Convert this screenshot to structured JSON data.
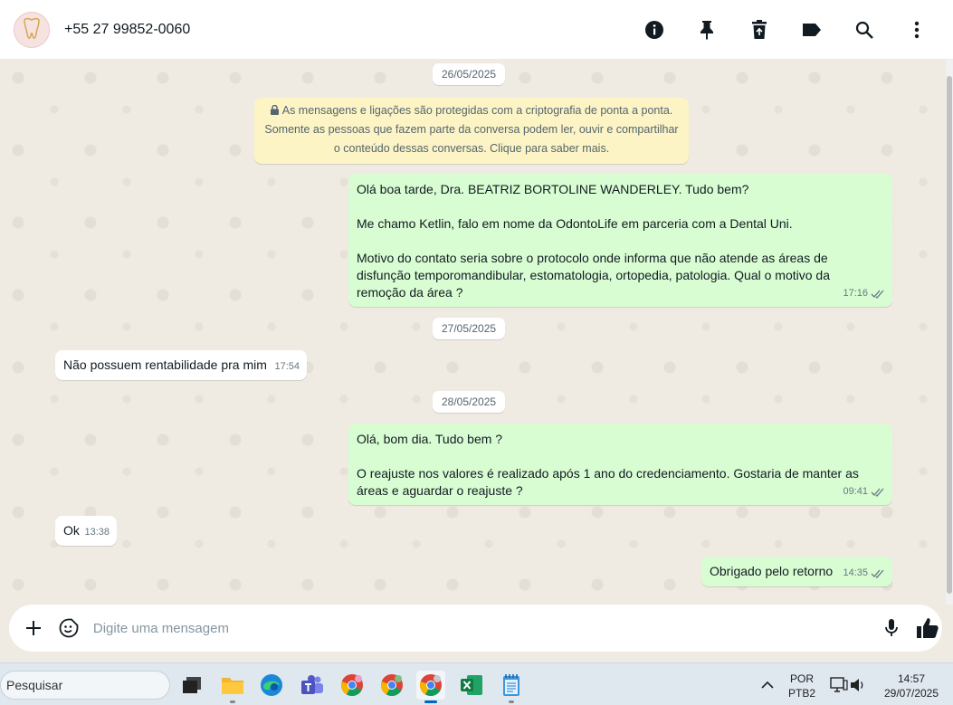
{
  "header": {
    "contact_name": "+55 27 99852-0060",
    "icons": [
      "info-icon",
      "pin-icon",
      "delete-icon",
      "label-icon",
      "search-icon",
      "more-options-icon"
    ]
  },
  "chat": {
    "dates": [
      "26/05/2025",
      "27/05/2025",
      "28/05/2025"
    ],
    "encryption_notice": "As mensagens e ligações são protegidas com a criptografia de ponta a ponta.\nSomente as pessoas que fazem parte da conversa podem ler, ouvir e compartilhar\no conteúdo dessas conversas. Clique para saber mais.",
    "messages": [
      {
        "direction": "out",
        "text": "Olá boa tarde, Dra. BEATRIZ BORTOLINE WANDERLEY. Tudo bem?\n\nMe chamo Ketlin, falo em nome da OdontoLife em parceria com a Dental Uni.\n\nMotivo do contato seria sobre o protocolo onde informa que não atende as áreas de\ndisfunção temporomandibular, estomatologia, ortopedia, patologia. Qual o motivo da\nremoção da área ?",
        "time": "17:16",
        "status": "read"
      },
      {
        "direction": "in",
        "text": "Não possuem rentabilidade pra mim",
        "time": "17:54"
      },
      {
        "direction": "out",
        "text": "Olá, bom dia. Tudo bem ?\n\nO reajuste nos valores é realizado após 1 ano do credenciamento. Gostaria de manter as\náreas e aguardar o reajuste ?",
        "time": "09:41",
        "status": "read"
      },
      {
        "direction": "in",
        "text": "Ok",
        "time": "13:38"
      },
      {
        "direction": "out",
        "text": "Obrigado pelo retorno",
        "time": "14:35",
        "status": "read"
      }
    ]
  },
  "composer": {
    "placeholder": "Digite uma mensagem",
    "icons": [
      "plus-icon",
      "sticker-icon",
      "microphone-icon",
      "like-icon"
    ]
  },
  "taskbar": {
    "search_placeholder": "Pesquisar",
    "apps": [
      "task-view",
      "file-explorer",
      "edge",
      "teams",
      "chrome-profile-1",
      "chrome-profile-2",
      "chrome-profile-3",
      "excel",
      "notepad"
    ],
    "language_line1": "POR",
    "language_line2": "PTB2",
    "time": "14:57",
    "date": "29/07/2025"
  },
  "colors": {
    "outgoing_bubble": "#d9fdd3",
    "incoming_bubble": "#ffffff",
    "chat_background": "#efeae2",
    "encryption_notice": "#fdf4c5",
    "read_ticks": "#667781"
  }
}
